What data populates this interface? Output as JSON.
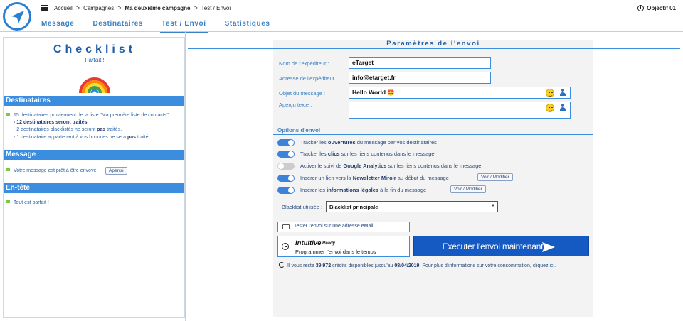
{
  "breadcrumb": {
    "items": [
      "Accueil",
      "Campagnes",
      "Ma deuxième campagne",
      "Test / Envoi"
    ]
  },
  "header": {
    "objectif": "Objectif 01"
  },
  "tabs": [
    {
      "label": "Message"
    },
    {
      "label": "Destinataires"
    },
    {
      "label": "Test / Envoi",
      "active": true
    },
    {
      "label": "Statistiques"
    }
  ],
  "checklist": {
    "title": "Checklist",
    "status": "Parfait !",
    "sections": {
      "destinataires": {
        "title": "Destinataires",
        "line1": "15 destinataires proviennent de la liste \"Ma première liste de contacts\".",
        "line2": "- 12 destinataires seront traités.",
        "line3_pre": "- 2 destinataires blacklistés ne seront ",
        "line3_bold": "pas",
        "line3_post": " traités.",
        "line4_pre": "- 1 destinataire appartenant à vos bounces ne sera ",
        "line4_bold": "pas",
        "line4_post": " traité."
      },
      "message": {
        "title": "Message",
        "text": "Votre message est prêt à être envoyé",
        "button": "Aperçu"
      },
      "entete": {
        "title": "En-tête",
        "text": "Tout est parfait !"
      }
    }
  },
  "params": {
    "title": "Paramètres de l'envoi",
    "sender_name_label": "Nom de l'expéditeur :",
    "sender_name_value": "eTarget",
    "sender_email_label": "Adresse de l'expéditeur :",
    "sender_email_value": "info@etarget.fr",
    "subject_label": "Objet du message :",
    "subject_value": "Hello World 🤩",
    "preview_label": "Aperçu texte :",
    "preview_value": ""
  },
  "options": {
    "title": "Options d'envoi",
    "items": [
      {
        "pre": "Tracker les ",
        "bold": "ouvertures",
        "post": " du message par vos destinataires",
        "on": true
      },
      {
        "pre": "Tracker les ",
        "bold": "clics",
        "post": " sur les liens contenus dans le message",
        "on": true
      },
      {
        "pre": "Activer le suivi de ",
        "bold": "Google Analytics",
        "post": " sur les liens contenus dans le message",
        "on": false
      },
      {
        "pre": "Insérer un lien vers la ",
        "bold": "Newsletter Miroir",
        "post": " au début du message",
        "on": true,
        "button": "Voir / Modifier"
      },
      {
        "pre": "Insérer les ",
        "bold": "informations légales",
        "post": " à la fin du message",
        "on": true,
        "button": "Voir / Modifier"
      }
    ]
  },
  "blacklist": {
    "label": "Blacklist utilisée :",
    "value": "Blacklist principale"
  },
  "actions": {
    "test_label": "Tester l'envoi sur une adresse eMail",
    "intuitive_name": "Intuitive",
    "intuitive_ready": "Ready",
    "intuitive_desc": "Programmer l'envoi dans le temps",
    "execute_label": "Exécuter l'envoi maintenant"
  },
  "credits": {
    "pre": "Il vous reste ",
    "count": "39 972",
    "mid": " crédits disponibles jusqu'au ",
    "date": "08/04/2019",
    "post": ". Pour plus d'informations sur votre consommation, cliquez ",
    "link": "ici",
    "end": "."
  },
  "colors": {
    "accent": "#3b8de0",
    "primary_button": "#1559c2"
  }
}
